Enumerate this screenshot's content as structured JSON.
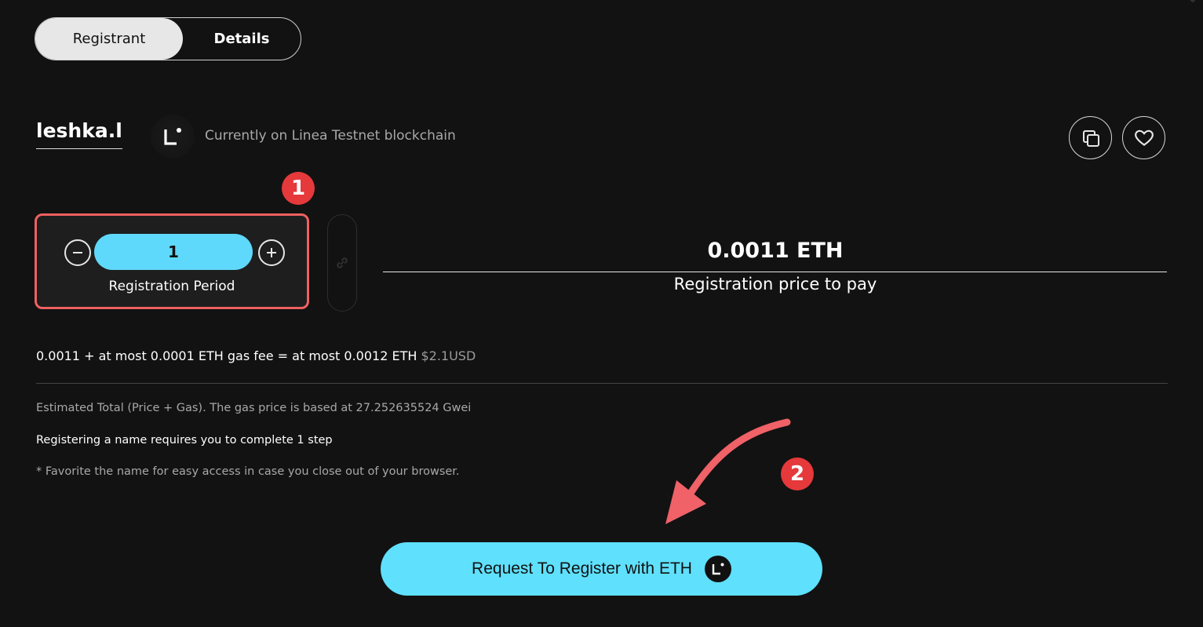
{
  "tabs": {
    "registrant": "Registrant",
    "details": "Details"
  },
  "domain": {
    "name": "leshka.l",
    "chain_text": "Currently on Linea Testnet blockchain"
  },
  "period": {
    "value": "1",
    "label": "Registration Period"
  },
  "price": {
    "value": "0.0011 ETH",
    "label": "Registration price to pay"
  },
  "fee": {
    "text": "0.0011 + at most 0.0001 ETH gas fee = at most 0.0012 ETH",
    "usd": "$2.1USD"
  },
  "notes": {
    "estimate": "Estimated Total (Price + Gas). The gas price is based at 27.252635524 Gwei",
    "steps": "Registering a name requires you to complete 1 step",
    "favorite": "* Favorite the name for easy access in case you close out of your browser."
  },
  "annotations": {
    "badge1": "1",
    "badge2": "2"
  },
  "register_button": {
    "label": "Request To Register with ETH"
  },
  "colors": {
    "background": "#121212",
    "accent": "#5fe0fd",
    "annotation": "#e5393b"
  },
  "icons": [
    "linea-logo-icon",
    "copy-icon",
    "heart-icon",
    "minus-icon",
    "plus-icon",
    "link-icon",
    "arrow-icon"
  ]
}
